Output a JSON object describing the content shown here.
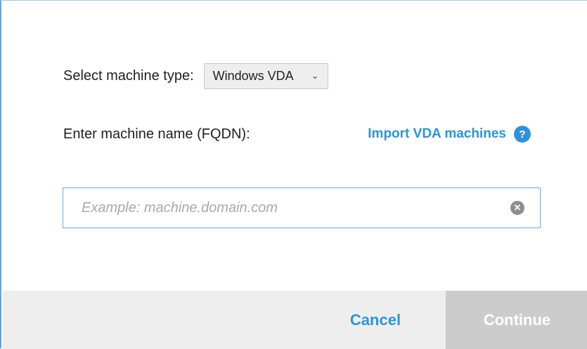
{
  "machine_type": {
    "label": "Select machine type:",
    "selected": "Windows VDA"
  },
  "machine_name": {
    "label": "Enter machine name (FQDN):",
    "import_link": "Import VDA machines",
    "help_glyph": "?",
    "placeholder": "Example: machine.domain.com",
    "value": ""
  },
  "footer": {
    "cancel_label": "Cancel",
    "continue_label": "Continue"
  },
  "colors": {
    "accent": "#2e93d6",
    "footer_bg": "#eeeeee",
    "continue_disabled_bg": "#cccccc",
    "input_border": "#6aaad6"
  },
  "icons": {
    "dropdown": "chevron-down-icon",
    "help": "help-icon",
    "clear": "clear-icon"
  }
}
